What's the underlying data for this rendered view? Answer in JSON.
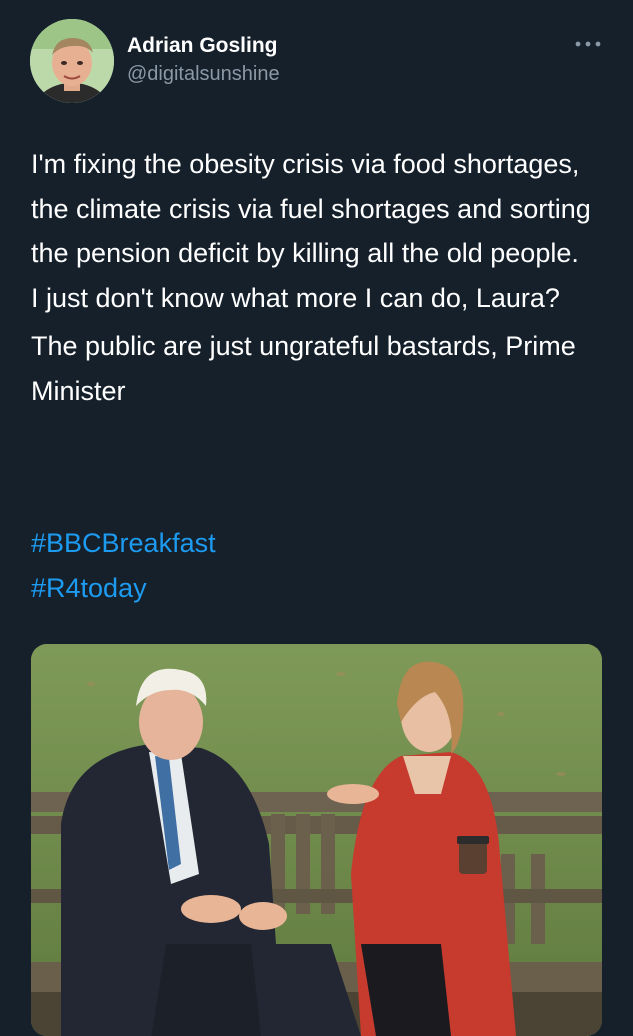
{
  "tweet": {
    "author": {
      "name": "Adrian Gosling",
      "handle": "@digitalsunshine"
    },
    "more_icon": "more-horizontal-icon",
    "paragraphs": [
      "I'm fixing the obesity crisis via food shortages, the climate crisis via fuel shortages and sorting the pension deficit by killing all the old people. I just don't know what more I can do, Laura?",
      "The public are just ungrateful bastards, Prime Minister"
    ],
    "hashtags": [
      "#BBCBreakfast",
      "#R4today"
    ],
    "colors": {
      "background": "#15202b",
      "text": "#ffffff",
      "secondary": "#8b98a5",
      "link": "#1d9bf0"
    }
  }
}
